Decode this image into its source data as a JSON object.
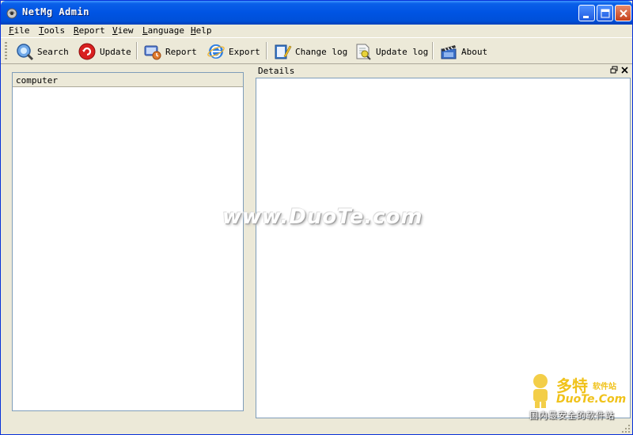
{
  "window": {
    "title": "NetMg Admin"
  },
  "menu": [
    {
      "label": "File",
      "key": "F",
      "rest": "ile"
    },
    {
      "label": "Tools",
      "key": "T",
      "rest": "ools"
    },
    {
      "label": "Report",
      "key": "R",
      "rest": "eport"
    },
    {
      "label": "View",
      "key": "V",
      "rest": "iew"
    },
    {
      "label": "Language",
      "key": "L",
      "rest": "anguage"
    },
    {
      "label": "Help",
      "key": "H",
      "rest": "elp"
    }
  ],
  "toolbar": {
    "search": "Search",
    "update": "Update",
    "report": "Report",
    "export": "Export",
    "change_log": "Change log",
    "update_log": "Update log",
    "about": "About"
  },
  "left_panel": {
    "column_header": "computer"
  },
  "details": {
    "title": "Details"
  },
  "watermark": {
    "site": "www.DuoTe.com",
    "logo_cn": "多特",
    "logo_cn_small": "软件站",
    "logo_en": "DuoTe.Com",
    "tagline": "国内最安全的软件站"
  },
  "colors": {
    "titlebar": "#0054E3",
    "chrome": "#ECE9D8",
    "panel_border": "#7F9DB9"
  }
}
